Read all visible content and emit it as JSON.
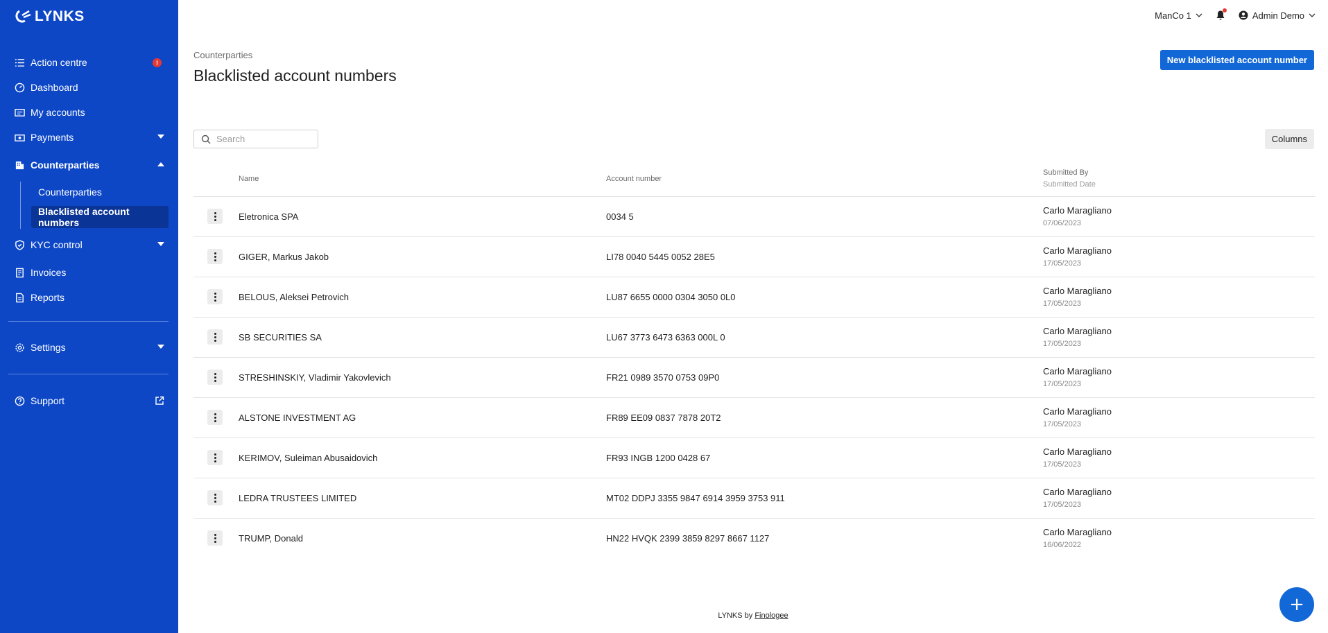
{
  "app": {
    "logo_text": "LYNKS",
    "brand_color": "#0d47c6",
    "accent_color": "#1268d6",
    "alert_color": "#e53935"
  },
  "sidebar": {
    "items": [
      {
        "label": "Action centre",
        "icon": "list-icon",
        "badge": "!"
      },
      {
        "label": "Dashboard",
        "icon": "dashboard-icon"
      },
      {
        "label": "My accounts",
        "icon": "accounts-icon"
      },
      {
        "label": "Payments",
        "icon": "payments-icon"
      },
      {
        "label": "Counterparties",
        "icon": "building-icon"
      },
      {
        "label": "KYC control",
        "icon": "shield-icon"
      },
      {
        "label": "Invoices",
        "icon": "invoice-icon"
      },
      {
        "label": "Reports",
        "icon": "report-icon"
      },
      {
        "label": "Settings",
        "icon": "gear-icon"
      },
      {
        "label": "Support",
        "icon": "help-icon"
      }
    ],
    "sub_items": [
      {
        "label": "Counterparties"
      },
      {
        "label": "Blacklisted account numbers"
      }
    ]
  },
  "topbar": {
    "company": "ManCo 1",
    "user": "Admin Demo"
  },
  "page": {
    "breadcrumb": "Counterparties",
    "title": "Blacklisted account numbers",
    "new_button": "New blacklisted account number",
    "search_placeholder": "Search",
    "columns_button": "Columns"
  },
  "table": {
    "headers": {
      "name": "Name",
      "account": "Account number",
      "submitted_by": "Submitted By",
      "submitted_date": "Submitted Date"
    },
    "rows": [
      {
        "name": "Eletronica SPA",
        "account": "0034 5",
        "by": "Carlo Maragliano",
        "date": "07/06/2023"
      },
      {
        "name": "GIGER, Markus Jakob",
        "account": "LI78 0040 5445 0052 28E5",
        "by": "Carlo Maragliano",
        "date": "17/05/2023"
      },
      {
        "name": "BELOUS, Aleksei Petrovich",
        "account": "LU87 6655 0000 0304 3050 0L0",
        "by": "Carlo Maragliano",
        "date": "17/05/2023"
      },
      {
        "name": "SB SECURITIES SA",
        "account": "LU67 3773 6473 6363 000L 0",
        "by": "Carlo Maragliano",
        "date": "17/05/2023"
      },
      {
        "name": "STRESHINSKIY, Vladimir Yakovlevich",
        "account": "FR21 0989 3570 0753 09P0",
        "by": "Carlo Maragliano",
        "date": "17/05/2023"
      },
      {
        "name": "ALSTONE INVESTMENT AG",
        "account": "FR89 EE09 0837 7878 20T2",
        "by": "Carlo Maragliano",
        "date": "17/05/2023"
      },
      {
        "name": "KERIMOV, Suleiman Abusaidovich",
        "account": "FR93 INGB 1200 0428 67",
        "by": "Carlo Maragliano",
        "date": "17/05/2023"
      },
      {
        "name": "LEDRA TRUSTEES LIMITED",
        "account": "MT02 DDPJ 3355 9847 6914 3959 3753 911",
        "by": "Carlo Maragliano",
        "date": "17/05/2023"
      },
      {
        "name": "TRUMP, Donald",
        "account": "HN22 HVQK 2399 3859 8297 8667 1127",
        "by": "Carlo Maragliano",
        "date": "16/06/2022"
      }
    ]
  },
  "footer": {
    "prefix": "LYNKS by",
    "link": "Finologee"
  },
  "fab": {
    "label": "+"
  }
}
